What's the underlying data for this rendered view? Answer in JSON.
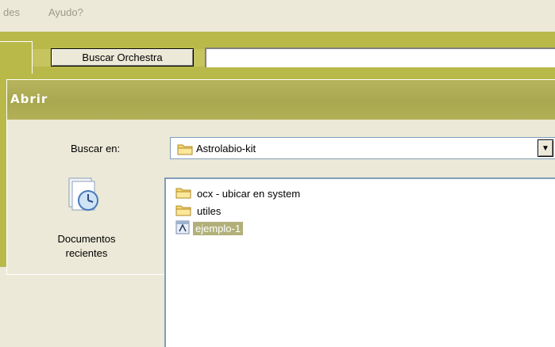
{
  "menubar": {
    "items": [
      {
        "label": "des"
      },
      {
        "label": "Ayudo?"
      }
    ]
  },
  "toolbar": {
    "search_button_label": "Buscar Orchestra",
    "search_value": ""
  },
  "dialog": {
    "title": "Abrir",
    "look_in_label": "Buscar en:",
    "look_in_value": "Astrolabio-kit",
    "sidebar": {
      "recent_label_line1": "Documentos",
      "recent_label_line2": "recientes"
    },
    "files": [
      {
        "name": "ocx - ubicar en system",
        "icon": "folder-icon",
        "selected": false
      },
      {
        "name": "utiles",
        "icon": "folder-icon",
        "selected": false
      },
      {
        "name": "ejemplo-1",
        "icon": "file-icon",
        "selected": true
      }
    ]
  },
  "colors": {
    "accent_olive": "#b9b94a",
    "selection": "#b2b07a",
    "folder": "#f6d86a"
  }
}
